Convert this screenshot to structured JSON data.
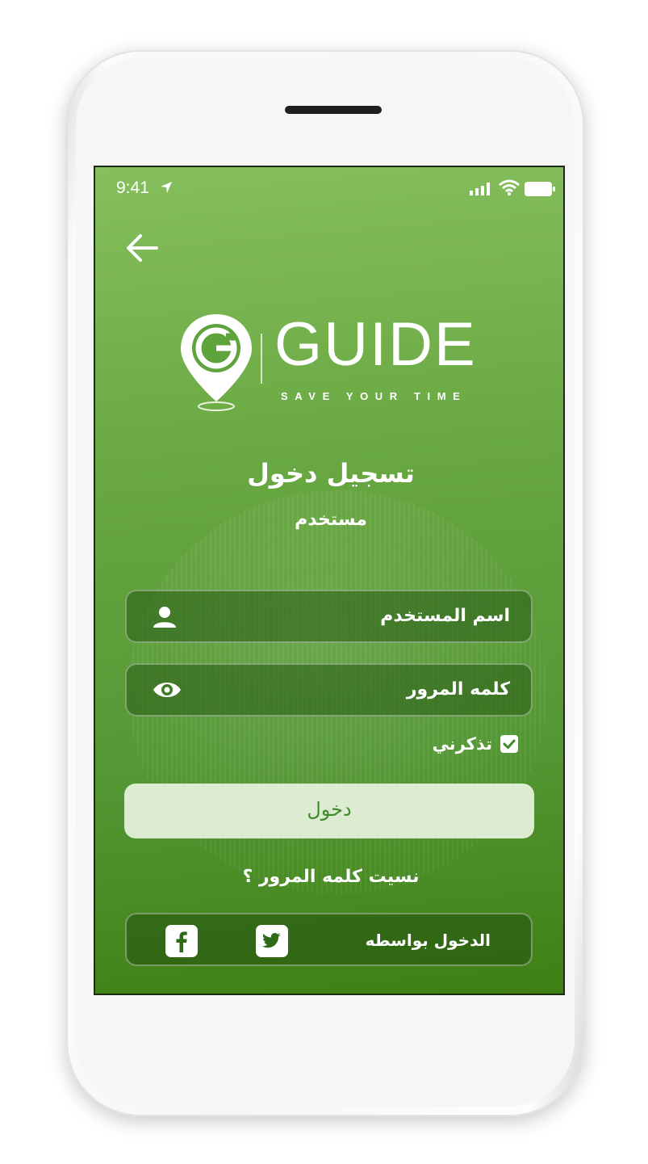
{
  "status_bar": {
    "time": "9:41"
  },
  "logo": {
    "word": "GUIDE",
    "tagline": "SAVE YOUR TIME"
  },
  "header": {
    "title": "تسجيل دخول",
    "subtitle": "مستخدم"
  },
  "form": {
    "username_label": "اسم المستخدم",
    "password_label": "كلمه المرور",
    "remember_label": "تذكرني",
    "remember_checked": true,
    "login_label": "دخول",
    "forgot_label": "نسيت كلمه المرور ؟"
  },
  "social": {
    "label": "الدخول بواسطه"
  },
  "colors": {
    "screen_top": "#86bf5e",
    "screen_bottom": "#3f8014",
    "button_text": "#3f8a2a"
  },
  "icons": [
    "location-arrow-icon",
    "signal-icon",
    "wifi-icon",
    "battery-icon",
    "back-arrow-icon",
    "guide-pin-logo",
    "user-icon",
    "eye-icon",
    "checkbox-icon",
    "facebook-icon",
    "twitter-icon"
  ]
}
